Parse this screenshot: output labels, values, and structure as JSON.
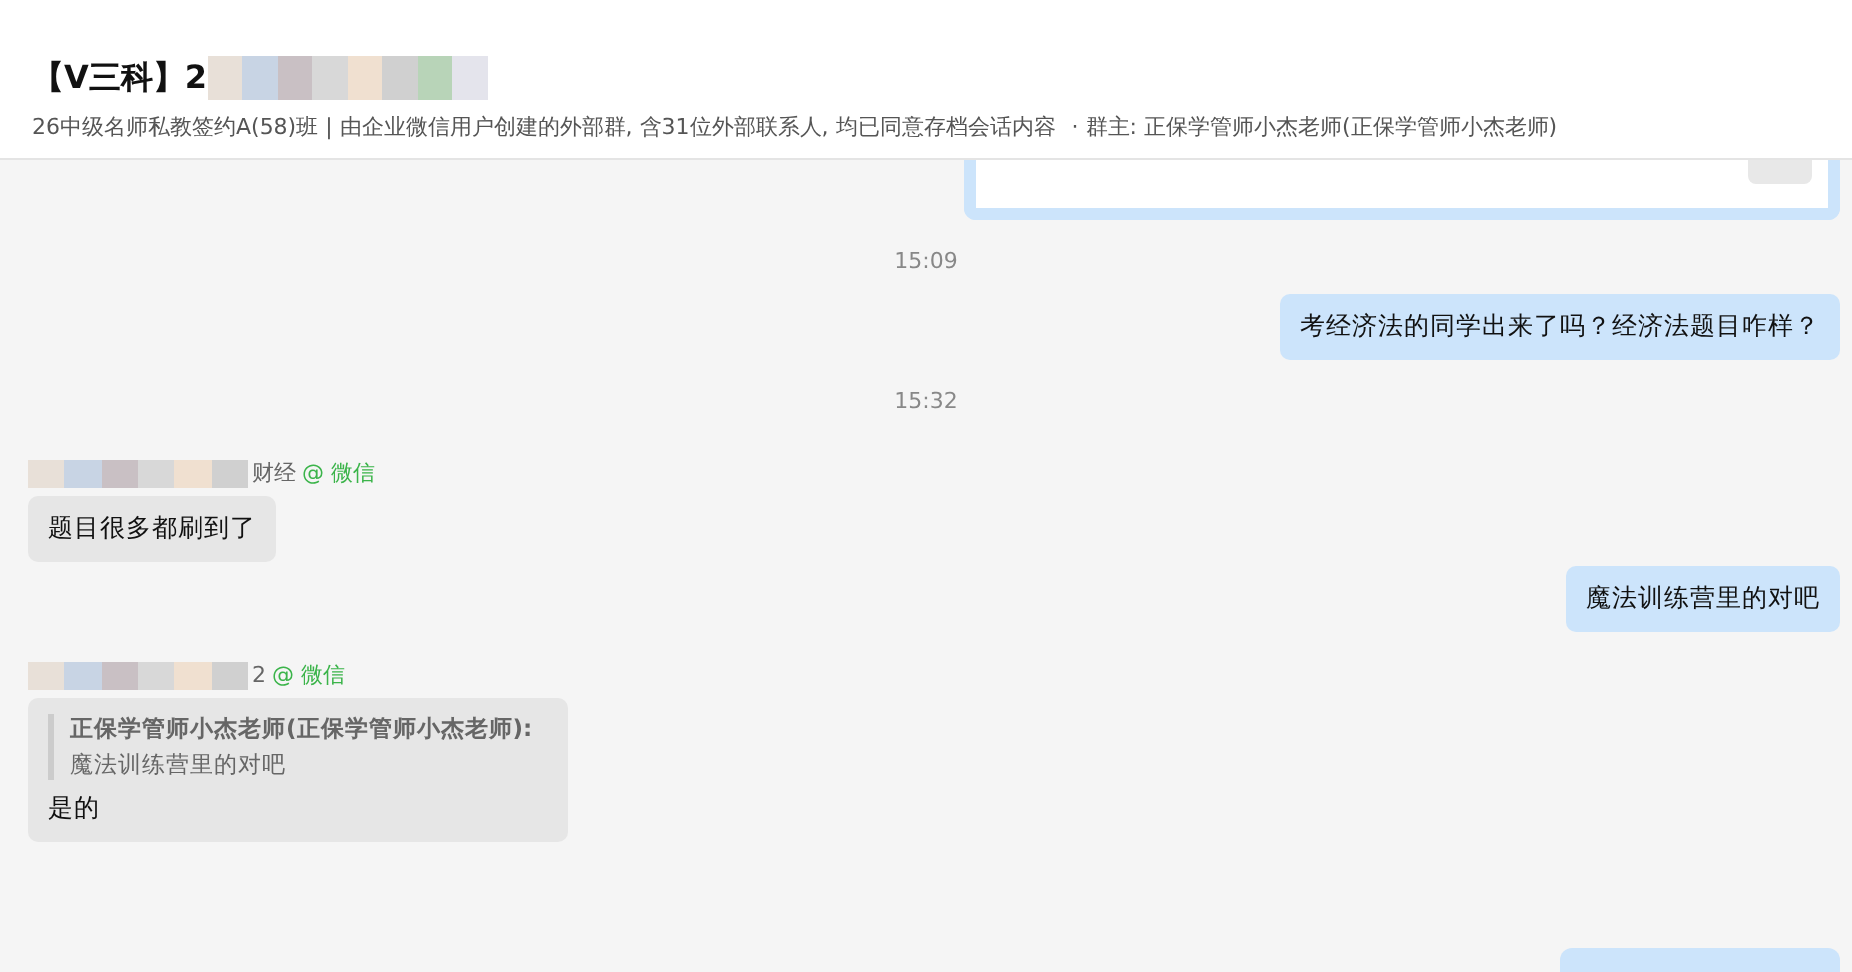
{
  "header": {
    "title": "【V三科】2",
    "subtitle": "26中级名师私教签约A(58)班 | 由企业微信用户创建的外部群, 含31位外部联系人,  均已同意存档会话内容",
    "owner": "· 群主: 正保学管师小杰老师(正保学管师小杰老师)"
  },
  "messages": [
    {
      "kind": "card_partial",
      "outgoing": true
    },
    {
      "kind": "time",
      "text": "15:09"
    },
    {
      "kind": "text",
      "outgoing": true,
      "text": "考经济法的同学出来了吗？经济法题目咋样？"
    },
    {
      "kind": "time",
      "text": "15:32"
    },
    {
      "kind": "text",
      "outgoing": false,
      "sender": "财经",
      "source": "@ 微信",
      "text": "题目很多都刷到了"
    },
    {
      "kind": "text",
      "outgoing": true,
      "text": "魔法训练营里的对吧"
    },
    {
      "kind": "quote",
      "outgoing": false,
      "sender": "2",
      "source": "@ 微信",
      "quote_author": "正保学管师小杰老师(正保学管师小杰老师):",
      "quote_text": "魔法训练营里的对吧",
      "text": "是的"
    },
    {
      "kind": "bubble_partial",
      "outgoing": true
    }
  ]
}
